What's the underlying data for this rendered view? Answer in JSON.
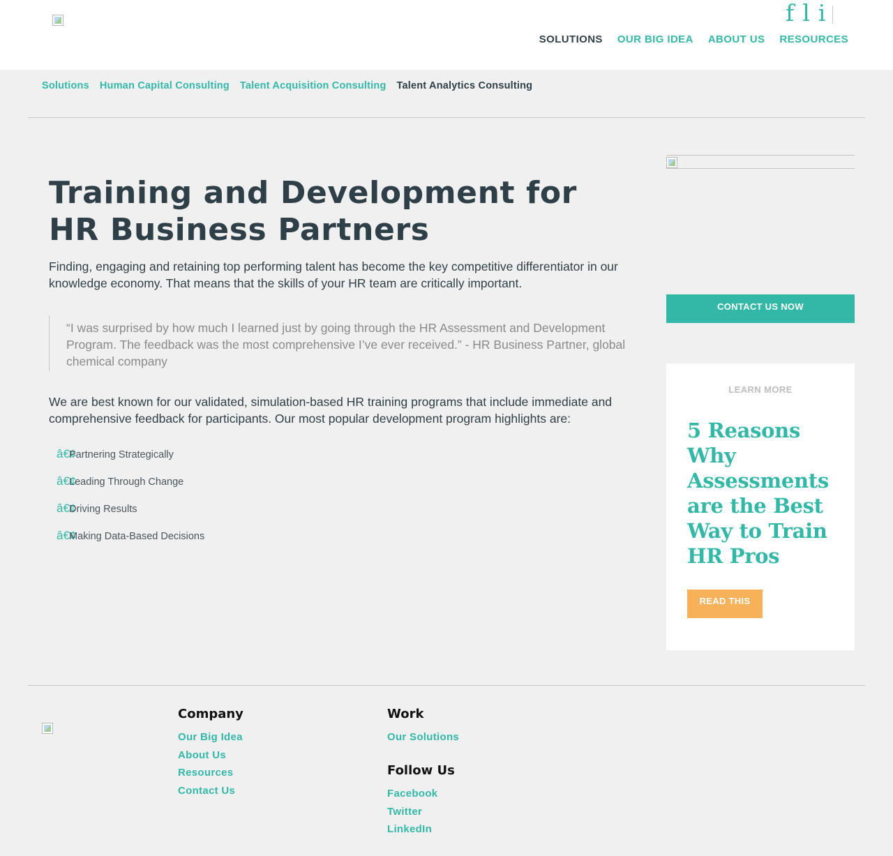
{
  "header": {
    "social_icons": [
      {
        "glyph": "f",
        "icon": "facebook-icon"
      },
      {
        "glyph": "l",
        "icon": "linkedin-icon"
      },
      {
        "glyph": "i",
        "icon": "instagram-icon"
      }
    ],
    "nav": [
      {
        "label": "SOLUTIONS",
        "active": true
      },
      {
        "label": "OUR BIG IDEA",
        "active": false
      },
      {
        "label": "ABOUT US",
        "active": false
      },
      {
        "label": "RESOURCES",
        "active": false
      }
    ]
  },
  "subnav": {
    "items": [
      {
        "label": "Solutions",
        "current": false
      },
      {
        "label": "Human Capital Consulting",
        "current": false
      },
      {
        "label": "Talent Acquisition Consulting",
        "current": false
      },
      {
        "label": "Talent Analytics Consulting",
        "current": true
      }
    ]
  },
  "main": {
    "title": "Training and Development for HR Business Partners",
    "lead": "Finding, engaging and retaining top performing talent has become the key competitive differentiator in our knowledge economy. That means that the skills of your HR team are critically important.",
    "quote": "“I was surprised by how much I learned just by going through the HR Assessment and Development Program. The feedback was the most comprehensive I’ve ever received.”  - HR Business Partner, global chemical company",
    "para2": "We are best known for our validated, simulation-based HR training programs that include immediate and  comprehensive feedback for participants. Our most popular development program highlights are:",
    "bullet_glyph": "â€¢",
    "bullets": [
      "Partnering Strategically",
      "Leading Through Change",
      "Driving Results",
      "Making Data-Based Decisions"
    ]
  },
  "sidebar": {
    "contact_label": "CONTACT US NOW",
    "promo_kicker": "LEARN MORE",
    "promo_title": "5 Reasons Why Assessments are the Best Way to Train HR Pros",
    "read_label": "READ THIS"
  },
  "footer": {
    "company_heading": "Company",
    "company_links": [
      "Our Big Idea",
      "About Us",
      "Resources",
      "Contact Us"
    ],
    "work_heading": "Work",
    "work_links": [
      "Our Solutions"
    ],
    "follow_heading": "Follow Us",
    "follow_links": [
      "Facebook",
      "Twitter",
      "LinkedIn"
    ]
  },
  "colors": {
    "accent": "#33b8a8",
    "dark": "#2f3f47",
    "cta_orange": "#f7b158",
    "background": "#f0f0f0"
  }
}
